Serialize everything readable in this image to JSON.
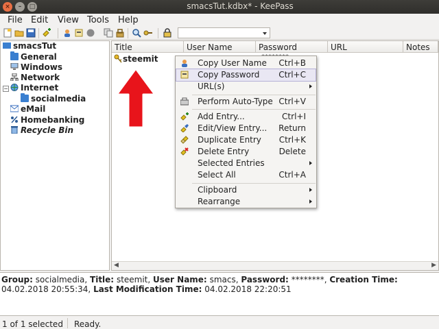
{
  "window": {
    "title": "smacsTut.kdbx* - KeePass",
    "close_glyph": "×",
    "min_glyph": "–",
    "max_glyph": "□"
  },
  "menubar": [
    "File",
    "Edit",
    "View",
    "Tools",
    "Help"
  ],
  "toolbar": {
    "search_value": ""
  },
  "tree": {
    "root": "smacsTut",
    "items": [
      "General",
      "Windows",
      "Network",
      "Internet",
      "socialmedia",
      "eMail",
      "Homebanking",
      "Recycle Bin"
    ]
  },
  "table": {
    "columns": [
      "Title",
      "User Name",
      "Password",
      "URL",
      "Notes"
    ],
    "rows": [
      {
        "title": "steemit",
        "password": "********"
      }
    ]
  },
  "context_menu": {
    "items": [
      {
        "label": "Copy User Name",
        "shortcut": "Ctrl+B"
      },
      {
        "label": "Copy Password",
        "shortcut": "Ctrl+C"
      },
      {
        "label": "URL(s)",
        "shortcut": ""
      },
      {
        "label": "Perform Auto-Type",
        "shortcut": "Ctrl+V"
      },
      {
        "label": "Add Entry...",
        "shortcut": "Ctrl+I"
      },
      {
        "label": "Edit/View Entry...",
        "shortcut": "Return"
      },
      {
        "label": "Duplicate Entry",
        "shortcut": "Ctrl+K"
      },
      {
        "label": "Delete Entry",
        "shortcut": "Delete"
      },
      {
        "label": "Selected Entries",
        "shortcut": ""
      },
      {
        "label": "Select All",
        "shortcut": "Ctrl+A"
      },
      {
        "label": "Clipboard",
        "shortcut": ""
      },
      {
        "label": "Rearrange",
        "shortcut": ""
      }
    ],
    "highlighted": "Copy Password"
  },
  "details": {
    "group_label": "Group:",
    "group": "socialmedia",
    "title_label": "Title:",
    "title": "steemit",
    "user_label": "User Name:",
    "user": "smacs",
    "password_label": "Password:",
    "password": "********",
    "created_label": "Creation Time:",
    "created": "04.02.2018 20:55:34",
    "modified_label": "Last Modification Time:",
    "modified": "04.02.2018 22:20:51"
  },
  "status": {
    "selection": "1 of 1 selected",
    "state": "Ready."
  },
  "colors": {
    "arrow": "#e8141b",
    "folder": "#3a7fd0",
    "highlight": "#e9e7f3"
  }
}
